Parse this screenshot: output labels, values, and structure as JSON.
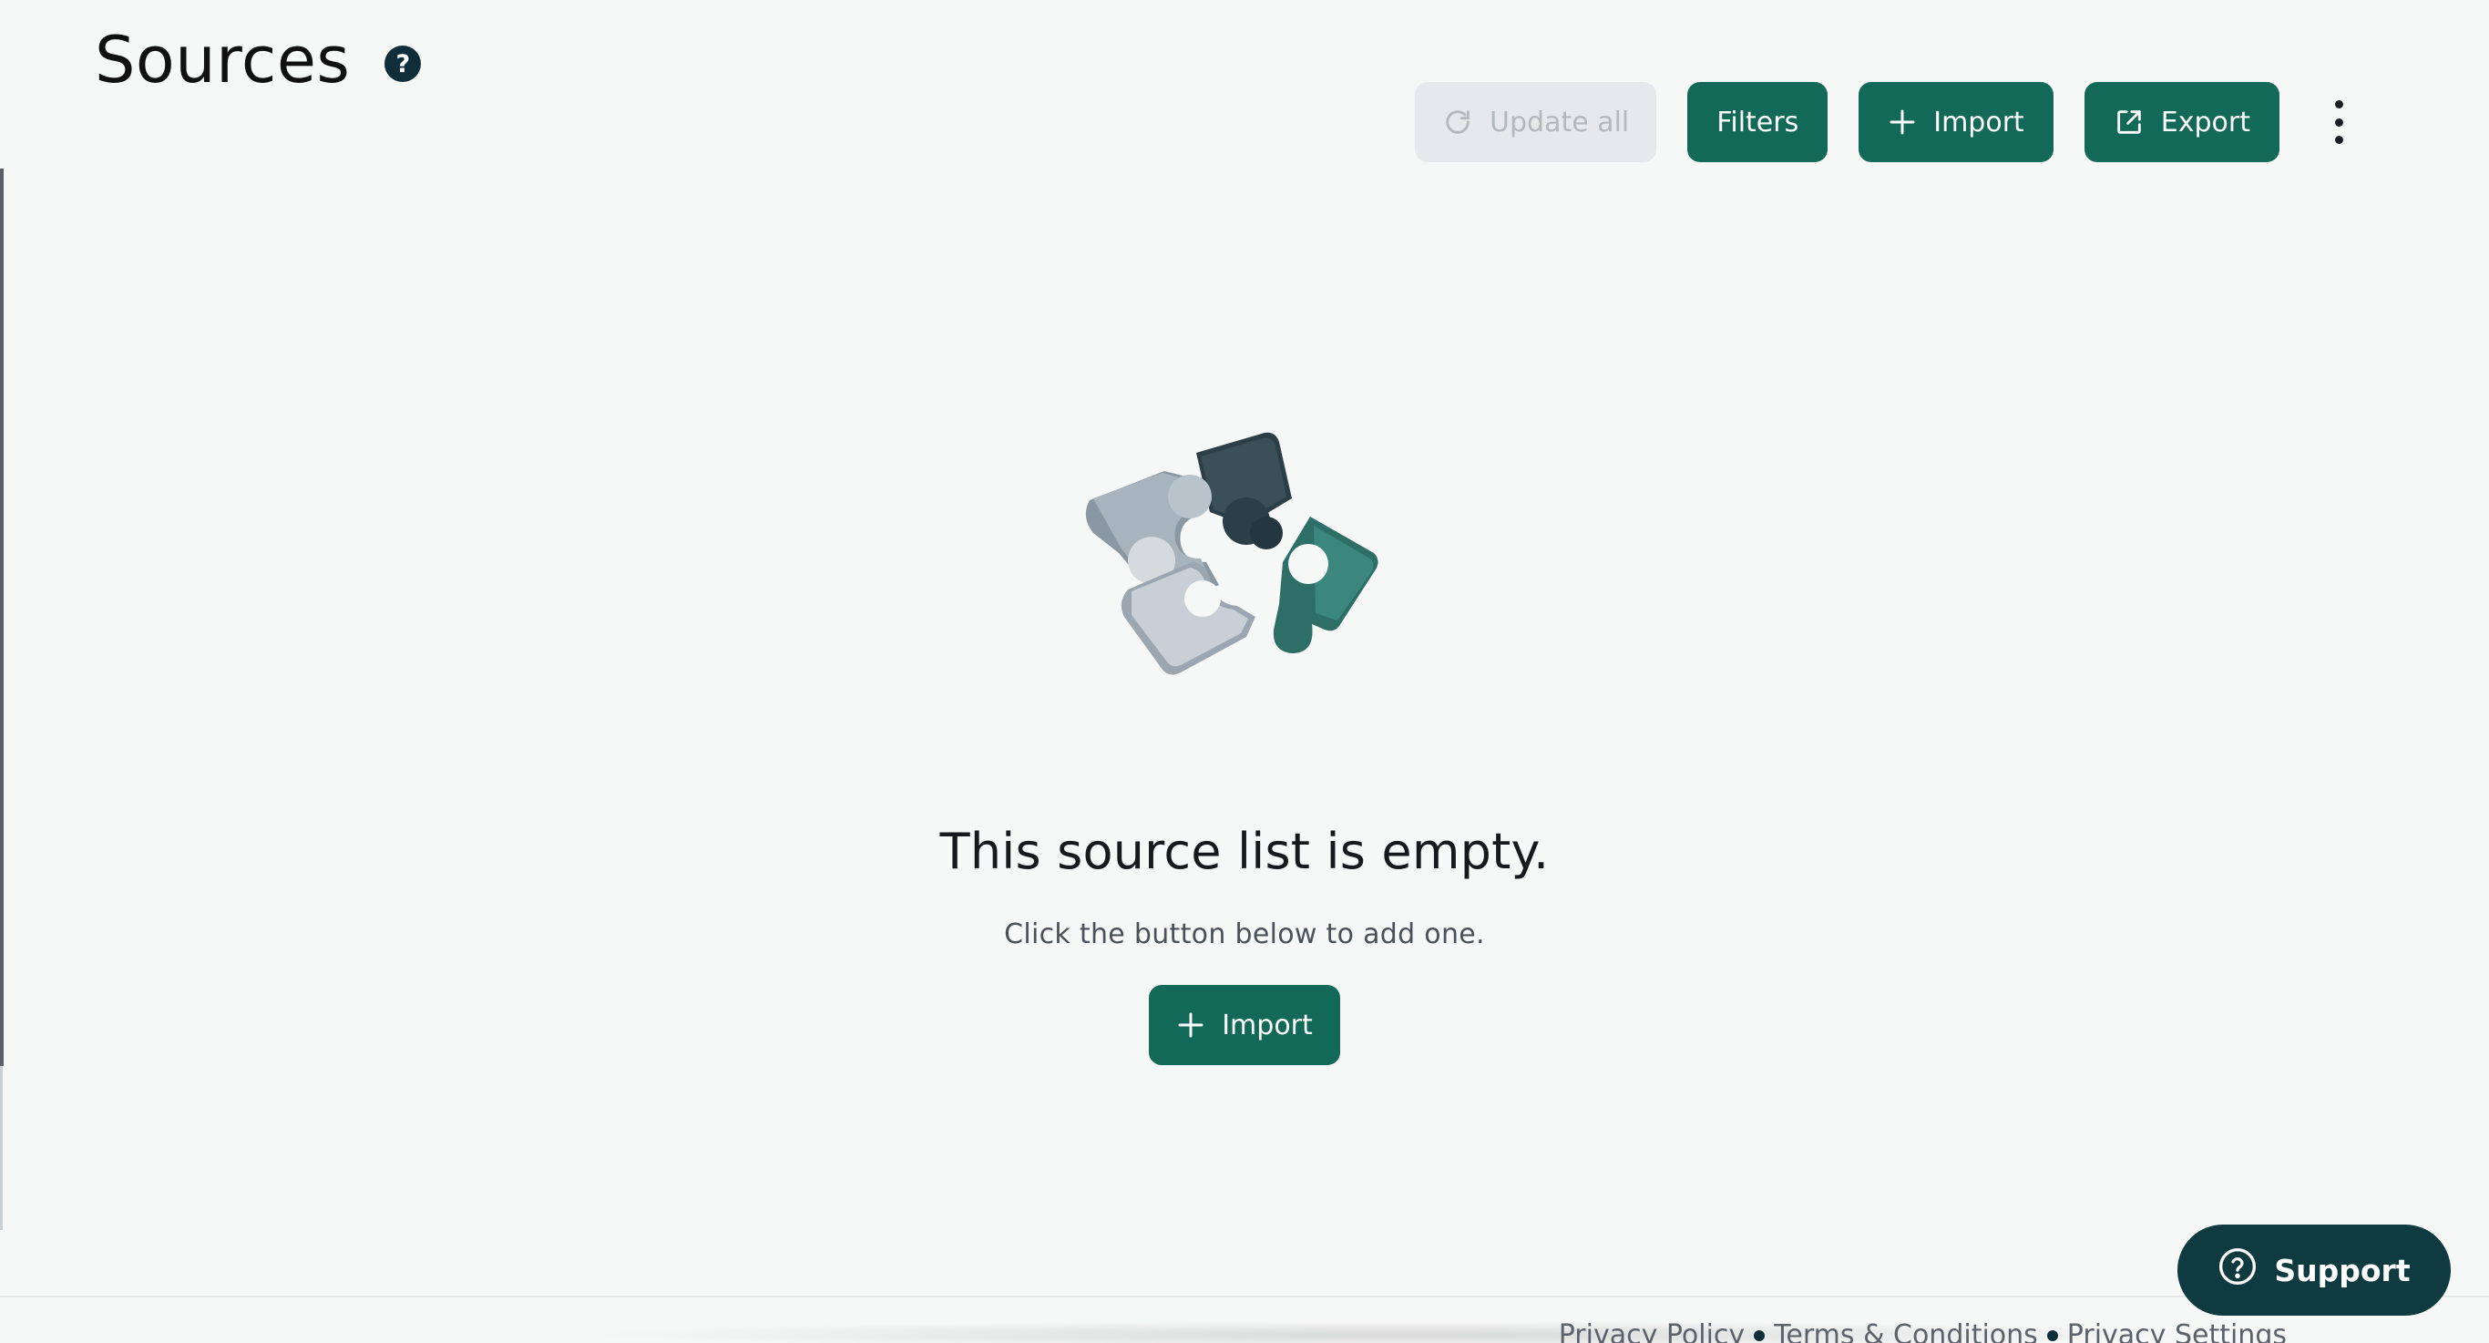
{
  "header": {
    "title": "Sources",
    "help_icon": "question-circle-icon"
  },
  "toolbar": {
    "update_all": {
      "label": "Update all",
      "icon": "refresh-icon",
      "disabled": true
    },
    "filters": {
      "label": "Filters"
    },
    "import": {
      "label": "Import",
      "icon": "plus-icon"
    },
    "export": {
      "label": "Export",
      "icon": "external-link-icon"
    },
    "more": {
      "icon": "kebab-menu-icon"
    }
  },
  "empty_state": {
    "illustration": "puzzle-pieces-illustration",
    "title": "This source list is empty.",
    "description": "Click the button below to add one.",
    "import_label": "Import"
  },
  "footer": {
    "links": [
      "Privacy Policy",
      "Terms & Conditions",
      "Privacy Settings"
    ]
  },
  "support": {
    "label": "Support",
    "icon": "question-circle-icon"
  },
  "colors": {
    "primary": "#136957",
    "disabled_bg": "#e6e8eb",
    "disabled_text": "#b3b8bf",
    "support_bg": "#0f3a40",
    "background": "#f6f7f7"
  }
}
